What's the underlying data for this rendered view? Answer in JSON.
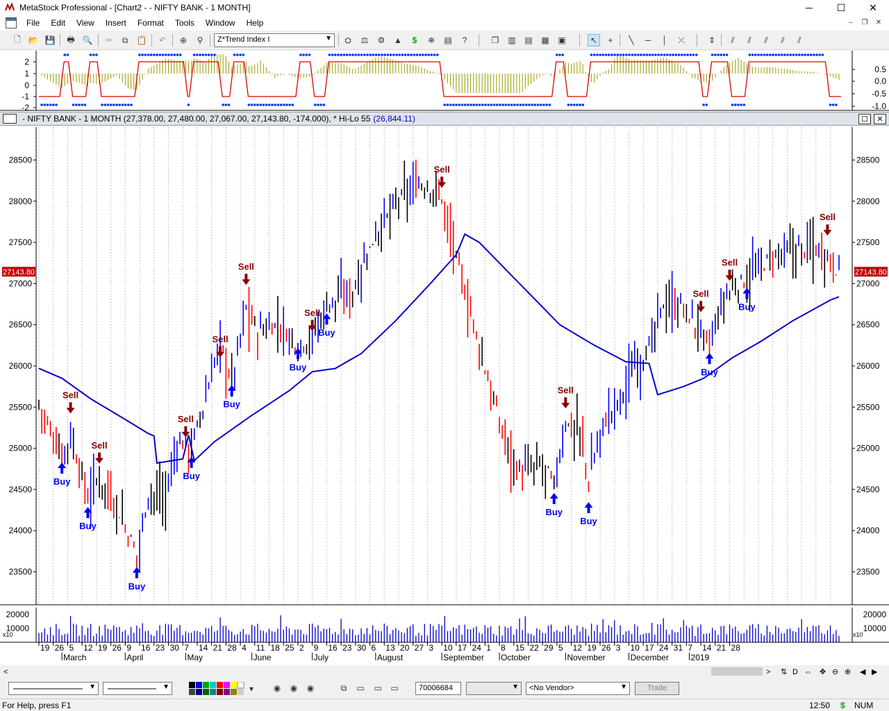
{
  "window": {
    "title": "MetaStock Professional - [Chart2 - - NIFTY BANK - 1 MONTH]",
    "minimize": "─",
    "maximize": "☐",
    "close": "✕"
  },
  "menu": {
    "items": [
      "File",
      "Edit",
      "View",
      "Insert",
      "Format",
      "Tools",
      "Window",
      "Help"
    ],
    "mdi_buttons": [
      "–",
      "❐",
      "✕"
    ]
  },
  "toolbar": {
    "indicator_select": "Z*Trend Index I",
    "icons": [
      "new-icon",
      "open-icon",
      "save-icon",
      "print-icon",
      "print-preview-icon",
      "cut-icon",
      "copy-icon",
      "paste-icon",
      "undo-icon",
      "crosshair-icon",
      "zoom-icon",
      "explorer-icon",
      "system-tester-icon",
      "expert-advisor-icon",
      "dollar-icon",
      "binoculars-icon",
      "indicator-builder-icon",
      "help-icon",
      "new-window-icon",
      "tile-vertical-icon",
      "tile-horizontal-icon",
      "tile-icon",
      "arrange-icon",
      "pointer-icon",
      "cross-icon",
      "trendline-icon",
      "horizontal-line-icon",
      "vertical-line-icon",
      "symbol-icon",
      "spacing-icon",
      "fan-icon",
      "arcs-icon",
      "retracement-icon",
      "cycle-icon"
    ]
  },
  "chart": {
    "symbol_line": "- NIFTY BANK - 1 MONTH (27,378.00, 27,480.00, 27,067.00, 27,143.80, -174.000), * Hi-Lo 55",
    "hilo_value": "(26,844.11)",
    "last_price_label": "27143.80",
    "indicator_axis_left": [
      "2",
      "1",
      "0",
      "-1",
      "-2"
    ],
    "indicator_axis_right": [
      "0.5",
      "0.0",
      "-0.5",
      "-1.0"
    ],
    "volume_axis": [
      "20000",
      "10000"
    ],
    "volume_multiplier": "x10",
    "date_ticks": [
      "19",
      "26",
      "5",
      "12",
      "19",
      "26",
      "9",
      "16",
      "23",
      "30",
      "7",
      "14",
      "21",
      "28",
      "4",
      "11",
      "18",
      "25",
      "2",
      "9",
      "16",
      "23",
      "30",
      "6",
      "13",
      "20",
      "27",
      "3",
      "10",
      "17",
      "24",
      "1",
      "8",
      "15",
      "22",
      "29",
      "5",
      "12",
      "19",
      "26",
      "3",
      "10",
      "17",
      "24",
      "31",
      "7",
      "14",
      "21",
      "28"
    ],
    "month_labels": [
      "March",
      "April",
      "May",
      "June",
      "July",
      "August",
      "September",
      "October",
      "November",
      "December",
      "2019"
    ],
    "signals": [
      {
        "type": "Buy",
        "date": "2018-03-01",
        "price": 24810
      },
      {
        "type": "Sell",
        "date": "2018-03-06",
        "price": 25440
      },
      {
        "type": "Buy",
        "date": "2018-03-14",
        "price": 24270
      },
      {
        "type": "Sell",
        "date": "2018-03-20",
        "price": 24830
      },
      {
        "type": "Buy",
        "date": "2018-04-06",
        "price": 23540
      },
      {
        "type": "Sell",
        "date": "2018-05-01",
        "price": 25150
      },
      {
        "type": "Buy",
        "date": "2018-05-03",
        "price": 24880
      },
      {
        "type": "Sell",
        "date": "2018-05-17",
        "price": 26120
      },
      {
        "type": "Buy",
        "date": "2018-05-23",
        "price": 25750
      },
      {
        "type": "Sell",
        "date": "2018-05-30",
        "price": 27000
      },
      {
        "type": "Buy",
        "date": "2018-06-25",
        "price": 26200
      },
      {
        "type": "Sell",
        "date": "2018-07-02",
        "price": 26440
      },
      {
        "type": "Buy",
        "date": "2018-07-09",
        "price": 26620
      },
      {
        "type": "Sell",
        "date": "2018-09-03",
        "price": 28180
      },
      {
        "type": "Buy",
        "date": "2018-10-26",
        "price": 24440
      },
      {
        "type": "Sell",
        "date": "2018-11-01",
        "price": 25500
      },
      {
        "type": "Buy",
        "date": "2018-11-13",
        "price": 24330
      },
      {
        "type": "Sell",
        "date": "2019-01-07",
        "price": 26670
      },
      {
        "type": "Buy",
        "date": "2019-01-10",
        "price": 26140
      },
      {
        "type": "Sell",
        "date": "2019-01-21",
        "price": 27050
      },
      {
        "type": "Buy",
        "date": "2019-01-29",
        "price": 26930
      },
      {
        "type": "Sell",
        "date": "2019-03-08",
        "price": 27600
      }
    ]
  },
  "chart_data": {
    "type": "line",
    "price_axis": {
      "ticks": [
        28500,
        28000,
        27500,
        27000,
        26500,
        26000,
        25500,
        25000,
        24500,
        24000,
        23500
      ],
      "ylim": [
        23100,
        28900
      ]
    },
    "hilo_55": [
      {
        "x": "2018-02-19",
        "y": 25970
      },
      {
        "x": "2018-03-01",
        "y": 25850
      },
      {
        "x": "2018-03-15",
        "y": 25600
      },
      {
        "x": "2018-04-01",
        "y": 25350
      },
      {
        "x": "2018-04-12",
        "y": 25180
      },
      {
        "x": "2018-04-16",
        "y": 25150
      },
      {
        "x": "2018-04-17",
        "y": 24820
      },
      {
        "x": "2018-04-30",
        "y": 24870
      },
      {
        "x": "2018-05-02",
        "y": 25160
      },
      {
        "x": "2018-05-04",
        "y": 24850
      },
      {
        "x": "2018-05-15",
        "y": 25080
      },
      {
        "x": "2018-06-01",
        "y": 25400
      },
      {
        "x": "2018-06-20",
        "y": 25700
      },
      {
        "x": "2018-07-01",
        "y": 25930
      },
      {
        "x": "2018-07-12",
        "y": 25970
      },
      {
        "x": "2018-07-25",
        "y": 26150
      },
      {
        "x": "2018-08-10",
        "y": 26550
      },
      {
        "x": "2018-08-28",
        "y": 27000
      },
      {
        "x": "2018-09-10",
        "y": 27350
      },
      {
        "x": "2018-09-13",
        "y": 27600
      },
      {
        "x": "2018-09-20",
        "y": 27500
      },
      {
        "x": "2018-10-10",
        "y": 27000
      },
      {
        "x": "2018-10-30",
        "y": 26500
      },
      {
        "x": "2018-11-15",
        "y": 26250
      },
      {
        "x": "2018-11-30",
        "y": 26050
      },
      {
        "x": "2018-12-12",
        "y": 26030
      },
      {
        "x": "2018-12-16",
        "y": 25650
      },
      {
        "x": "2018-12-28",
        "y": 25750
      },
      {
        "x": "2019-01-08",
        "y": 25850
      },
      {
        "x": "2019-01-22",
        "y": 26100
      },
      {
        "x": "2019-02-05",
        "y": 26300
      },
      {
        "x": "2019-02-20",
        "y": 26550
      },
      {
        "x": "2019-03-10",
        "y": 26800
      },
      {
        "x": "2019-03-14",
        "y": 26840
      }
    ],
    "volume_series": "daily volume bars, roughly 5000–20000 (x10)",
    "legend": "none"
  },
  "bottom_bar": {
    "line_style_1": "",
    "line_style_2": "",
    "security_field": "70006684",
    "blank_combo": "",
    "vendor": "<No Vendor>",
    "trade": "Trade"
  },
  "status": {
    "help": "For Help, press F1",
    "time": "12:50",
    "money": "$",
    "num": "NUM"
  },
  "colors": {
    "up_bar": "#0000ff",
    "down_bar": "#ff0000",
    "neutral_bar": "#000000",
    "hilo_line": "#0000cc",
    "buy": "#0000ee",
    "sell": "#8b0000",
    "indicator_hist": "#9a9a00",
    "indicator_line": "#e00000",
    "dots": "#0033ff"
  }
}
